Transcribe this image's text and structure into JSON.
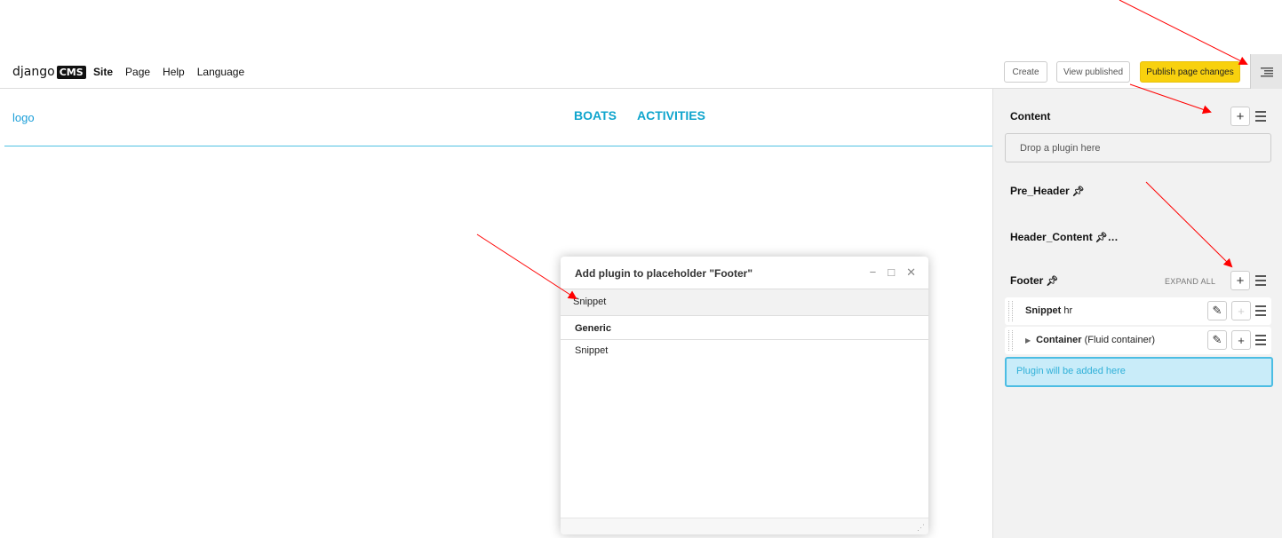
{
  "toolbar": {
    "brand_text": "django",
    "brand_badge": "CMS",
    "menu": [
      "Site",
      "Page",
      "Help",
      "Language"
    ],
    "create_label": "Create",
    "view_published_label": "View published",
    "publish_label": "Publish page changes",
    "sidebar_toggle_icon": "structure-toggle-icon"
  },
  "page": {
    "logo": "logo",
    "nav": [
      "BOATS",
      "ACTIVITIES"
    ]
  },
  "structure": {
    "content_title": "Content",
    "content_drop": "Drop a plugin here",
    "pre_header_title": "Pre_Header",
    "header_content_title": "Header_Content",
    "header_content_ellipsis": "…",
    "footer_title": "Footer",
    "expand_all": "EXPAND ALL",
    "plugins": [
      {
        "name": "Snippet",
        "detail": "hr"
      },
      {
        "name": "Container",
        "detail": "(Fluid container)"
      }
    ],
    "add_here": "Plugin will be added here",
    "pin_icon": "pin-icon"
  },
  "modal": {
    "title": "Add plugin to placeholder \"Footer\"",
    "search_value": "Snippet",
    "group": "Generic",
    "items": [
      "Snippet"
    ],
    "minimize": "−",
    "maximize": "□",
    "close": "✕"
  },
  "colors": {
    "publish": "#f8d10e",
    "accent": "#10a5cd",
    "annotation_arrow": "#ff0000"
  }
}
